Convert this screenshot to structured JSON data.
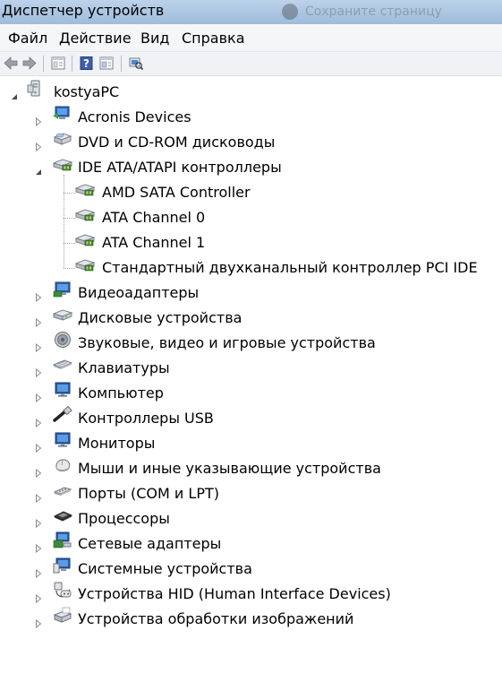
{
  "window": {
    "title": "Диспетчер устройств",
    "background_window_title": "Сохраните страницу"
  },
  "menu": {
    "items": [
      {
        "label": "Файл"
      },
      {
        "label": "Действие"
      },
      {
        "label": "Вид"
      },
      {
        "label": "Справка"
      }
    ]
  },
  "toolbar": {
    "buttons": [
      "back-icon",
      "forward-icon",
      "properties-icon",
      "help-icon",
      "pane-icon",
      "scan-hardware-icon"
    ]
  },
  "tree": {
    "root": {
      "label": "kostyaPC",
      "icon": "computer-icon",
      "expanded": true
    },
    "categories": [
      {
        "label": "Acronis Devices",
        "icon": "acronis-icon",
        "expanded": false
      },
      {
        "label": "DVD и CD-ROM дисководы",
        "icon": "dvd-drive-icon",
        "expanded": false
      },
      {
        "label": "IDE ATA/ATAPI контроллеры",
        "icon": "ide-controller-icon",
        "expanded": true,
        "children": [
          {
            "label": "AMD SATA Controller",
            "icon": "ide-controller-icon"
          },
          {
            "label": "ATA Channel 0",
            "icon": "ide-controller-icon"
          },
          {
            "label": "ATA Channel 1",
            "icon": "ide-controller-icon"
          },
          {
            "label": "Стандартный двухканальный контроллер PCI IDE",
            "icon": "ide-controller-icon"
          }
        ]
      },
      {
        "label": "Видеоадаптеры",
        "icon": "display-adapter-icon",
        "expanded": false
      },
      {
        "label": "Дисковые устройства",
        "icon": "disk-drive-icon",
        "expanded": false
      },
      {
        "label": "Звуковые, видео и игровые устройства",
        "icon": "speaker-icon",
        "expanded": false
      },
      {
        "label": "Клавиатуры",
        "icon": "keyboard-icon",
        "expanded": false
      },
      {
        "label": "Компьютер",
        "icon": "monitor-icon",
        "expanded": false
      },
      {
        "label": "Контроллеры USB",
        "icon": "usb-icon",
        "expanded": false
      },
      {
        "label": "Мониторы",
        "icon": "monitor-icon",
        "expanded": false
      },
      {
        "label": "Мыши и иные указывающие устройства",
        "icon": "mouse-icon",
        "expanded": false
      },
      {
        "label": "Порты (COM и LPT)",
        "icon": "port-icon",
        "expanded": false
      },
      {
        "label": "Процессоры",
        "icon": "processor-icon",
        "expanded": false
      },
      {
        "label": "Сетевые адаптеры",
        "icon": "network-adapter-icon",
        "expanded": false
      },
      {
        "label": "Системные устройства",
        "icon": "system-device-icon",
        "expanded": false
      },
      {
        "label": "Устройства HID (Human Interface Devices)",
        "icon": "hid-icon",
        "expanded": false
      },
      {
        "label": "Устройства обработки изображений",
        "icon": "imaging-device-icon",
        "expanded": false
      }
    ]
  }
}
